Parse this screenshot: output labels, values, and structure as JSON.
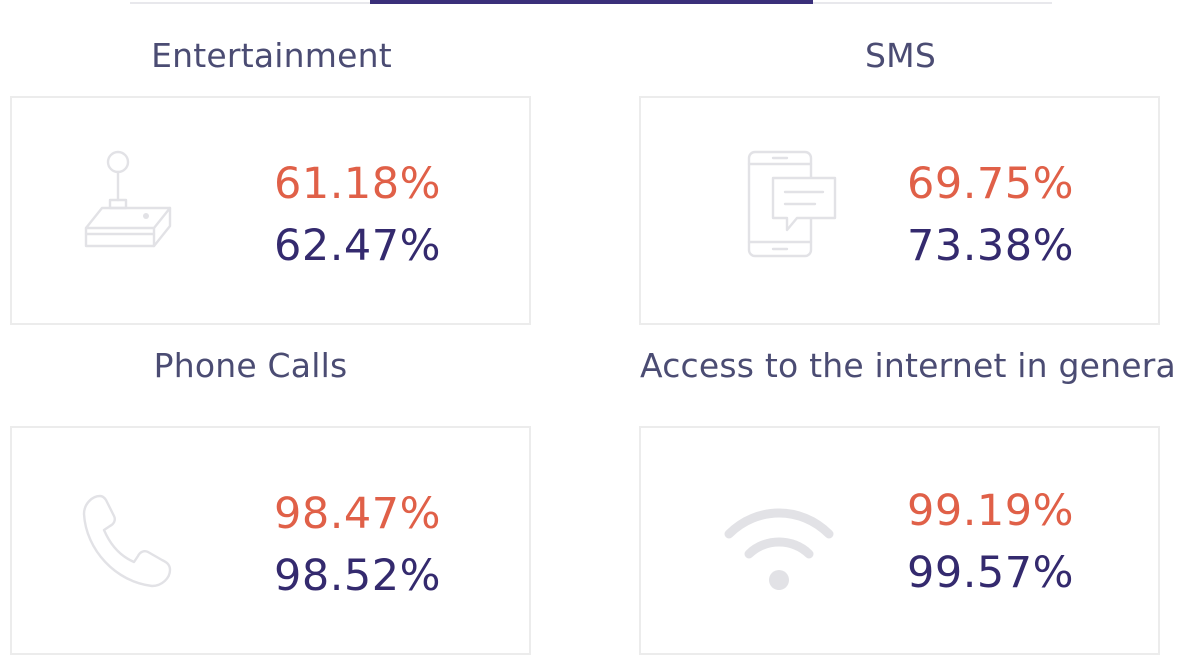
{
  "cards": [
    {
      "title": "Entertainment",
      "value_a": "61.18%",
      "value_b": "62.47%",
      "icon": "joystick-icon"
    },
    {
      "title": "SMS",
      "value_a": "69.75%",
      "value_b": "73.38%",
      "icon": "phone-message-icon"
    },
    {
      "title": "Phone Calls",
      "value_a": "98.47%",
      "value_b": "98.52%",
      "icon": "phone-handset-icon"
    },
    {
      "title": "Access to the internet in general",
      "value_a": "99.19%",
      "value_b": "99.57%",
      "icon": "wifi-icon"
    }
  ],
  "colors": {
    "value_a": "#e06048",
    "value_b": "#342a6e",
    "title": "#4b4c73",
    "tab_active": "#3a2f7a"
  }
}
